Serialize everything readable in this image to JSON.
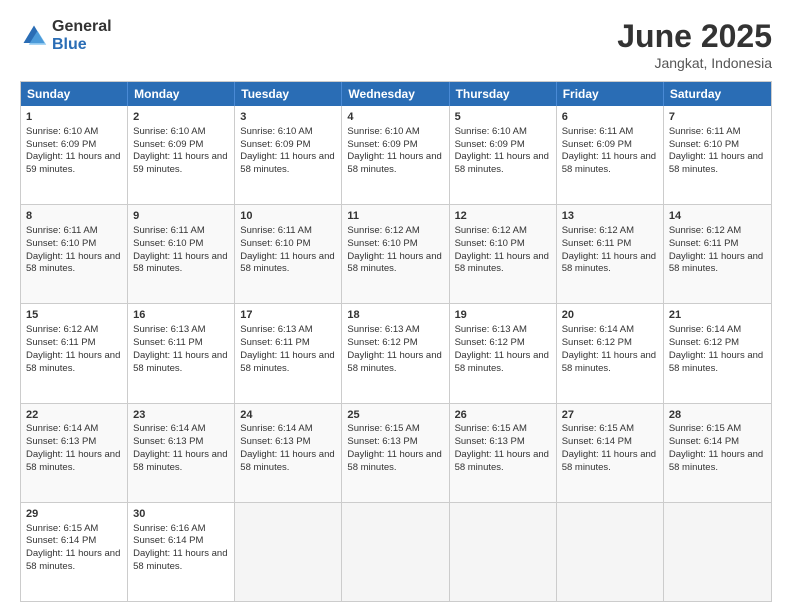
{
  "logo": {
    "general": "General",
    "blue": "Blue"
  },
  "title": {
    "month": "June 2025",
    "location": "Jangkat, Indonesia"
  },
  "calendar": {
    "days": [
      "Sunday",
      "Monday",
      "Tuesday",
      "Wednesday",
      "Thursday",
      "Friday",
      "Saturday"
    ],
    "rows": [
      [
        {
          "day": "1",
          "sunrise": "6:10 AM",
          "sunset": "6:09 PM",
          "daylight": "11 hours and 59 minutes."
        },
        {
          "day": "2",
          "sunrise": "6:10 AM",
          "sunset": "6:09 PM",
          "daylight": "11 hours and 59 minutes."
        },
        {
          "day": "3",
          "sunrise": "6:10 AM",
          "sunset": "6:09 PM",
          "daylight": "11 hours and 58 minutes."
        },
        {
          "day": "4",
          "sunrise": "6:10 AM",
          "sunset": "6:09 PM",
          "daylight": "11 hours and 58 minutes."
        },
        {
          "day": "5",
          "sunrise": "6:10 AM",
          "sunset": "6:09 PM",
          "daylight": "11 hours and 58 minutes."
        },
        {
          "day": "6",
          "sunrise": "6:11 AM",
          "sunset": "6:09 PM",
          "daylight": "11 hours and 58 minutes."
        },
        {
          "day": "7",
          "sunrise": "6:11 AM",
          "sunset": "6:10 PM",
          "daylight": "11 hours and 58 minutes."
        }
      ],
      [
        {
          "day": "8",
          "sunrise": "6:11 AM",
          "sunset": "6:10 PM",
          "daylight": "11 hours and 58 minutes."
        },
        {
          "day": "9",
          "sunrise": "6:11 AM",
          "sunset": "6:10 PM",
          "daylight": "11 hours and 58 minutes."
        },
        {
          "day": "10",
          "sunrise": "6:11 AM",
          "sunset": "6:10 PM",
          "daylight": "11 hours and 58 minutes."
        },
        {
          "day": "11",
          "sunrise": "6:12 AM",
          "sunset": "6:10 PM",
          "daylight": "11 hours and 58 minutes."
        },
        {
          "day": "12",
          "sunrise": "6:12 AM",
          "sunset": "6:10 PM",
          "daylight": "11 hours and 58 minutes."
        },
        {
          "day": "13",
          "sunrise": "6:12 AM",
          "sunset": "6:11 PM",
          "daylight": "11 hours and 58 minutes."
        },
        {
          "day": "14",
          "sunrise": "6:12 AM",
          "sunset": "6:11 PM",
          "daylight": "11 hours and 58 minutes."
        }
      ],
      [
        {
          "day": "15",
          "sunrise": "6:12 AM",
          "sunset": "6:11 PM",
          "daylight": "11 hours and 58 minutes."
        },
        {
          "day": "16",
          "sunrise": "6:13 AM",
          "sunset": "6:11 PM",
          "daylight": "11 hours and 58 minutes."
        },
        {
          "day": "17",
          "sunrise": "6:13 AM",
          "sunset": "6:11 PM",
          "daylight": "11 hours and 58 minutes."
        },
        {
          "day": "18",
          "sunrise": "6:13 AM",
          "sunset": "6:12 PM",
          "daylight": "11 hours and 58 minutes."
        },
        {
          "day": "19",
          "sunrise": "6:13 AM",
          "sunset": "6:12 PM",
          "daylight": "11 hours and 58 minutes."
        },
        {
          "day": "20",
          "sunrise": "6:14 AM",
          "sunset": "6:12 PM",
          "daylight": "11 hours and 58 minutes."
        },
        {
          "day": "21",
          "sunrise": "6:14 AM",
          "sunset": "6:12 PM",
          "daylight": "11 hours and 58 minutes."
        }
      ],
      [
        {
          "day": "22",
          "sunrise": "6:14 AM",
          "sunset": "6:13 PM",
          "daylight": "11 hours and 58 minutes."
        },
        {
          "day": "23",
          "sunrise": "6:14 AM",
          "sunset": "6:13 PM",
          "daylight": "11 hours and 58 minutes."
        },
        {
          "day": "24",
          "sunrise": "6:14 AM",
          "sunset": "6:13 PM",
          "daylight": "11 hours and 58 minutes."
        },
        {
          "day": "25",
          "sunrise": "6:15 AM",
          "sunset": "6:13 PM",
          "daylight": "11 hours and 58 minutes."
        },
        {
          "day": "26",
          "sunrise": "6:15 AM",
          "sunset": "6:13 PM",
          "daylight": "11 hours and 58 minutes."
        },
        {
          "day": "27",
          "sunrise": "6:15 AM",
          "sunset": "6:14 PM",
          "daylight": "11 hours and 58 minutes."
        },
        {
          "day": "28",
          "sunrise": "6:15 AM",
          "sunset": "6:14 PM",
          "daylight": "11 hours and 58 minutes."
        }
      ],
      [
        {
          "day": "29",
          "sunrise": "6:15 AM",
          "sunset": "6:14 PM",
          "daylight": "11 hours and 58 minutes."
        },
        {
          "day": "30",
          "sunrise": "6:16 AM",
          "sunset": "6:14 PM",
          "daylight": "11 hours and 58 minutes."
        },
        {
          "day": "",
          "sunrise": "",
          "sunset": "",
          "daylight": ""
        },
        {
          "day": "",
          "sunrise": "",
          "sunset": "",
          "daylight": ""
        },
        {
          "day": "",
          "sunrise": "",
          "sunset": "",
          "daylight": ""
        },
        {
          "day": "",
          "sunrise": "",
          "sunset": "",
          "daylight": ""
        },
        {
          "day": "",
          "sunrise": "",
          "sunset": "",
          "daylight": ""
        }
      ]
    ]
  }
}
